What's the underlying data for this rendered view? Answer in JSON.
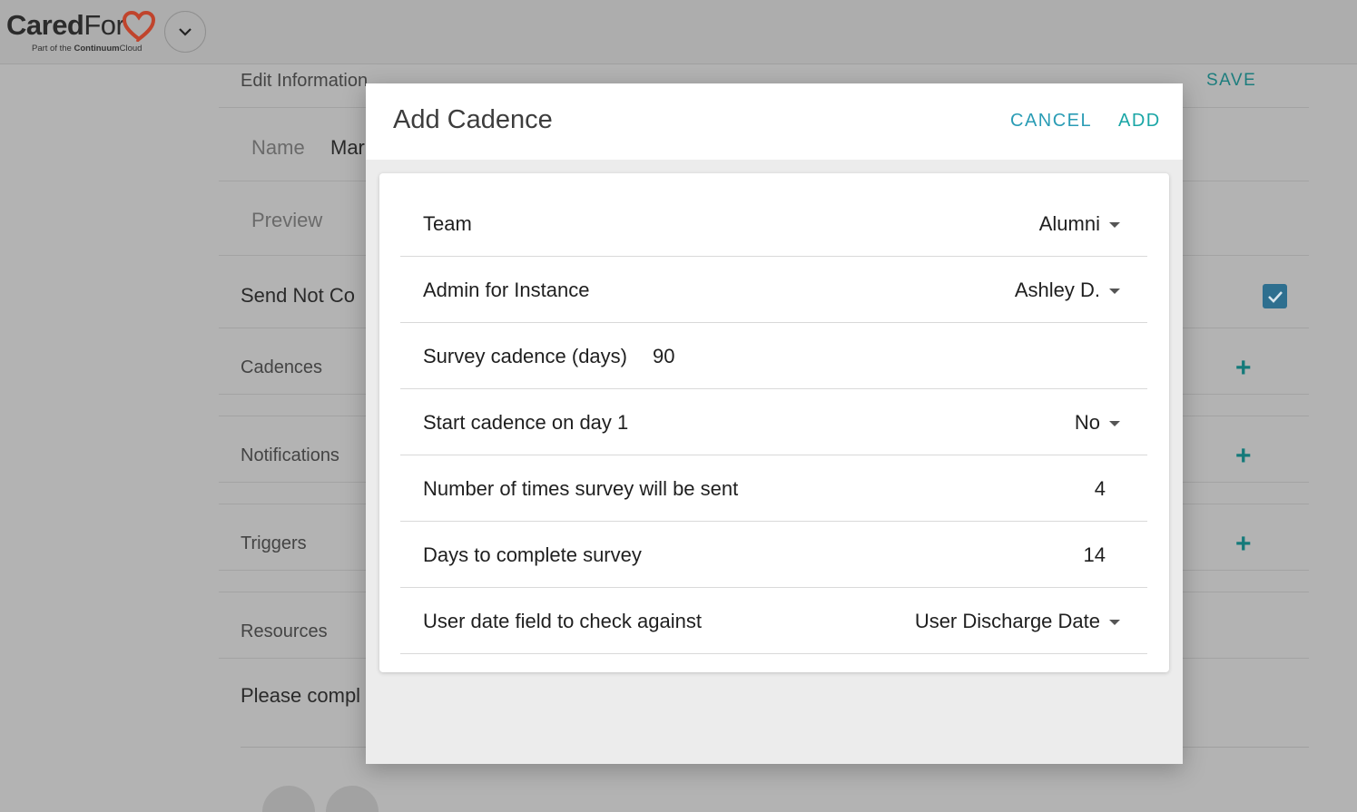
{
  "app": {
    "brand_main_bold": "Cared",
    "brand_main_light": "For",
    "brand_sub_prefix": "Part of the ",
    "brand_sub_bold": "Continuum",
    "brand_sub_suffix": "Cloud"
  },
  "background": {
    "edit_info_title": "Edit Information",
    "save_label": "SAVE",
    "name_label": "Name",
    "name_value_partial": "Mar",
    "preview_label": "Preview",
    "send_label_partial": "Send Not Co",
    "sections": [
      "Cadences",
      "Notifications",
      "Triggers",
      "Resources"
    ],
    "resources_text_partial": "Please compl"
  },
  "modal": {
    "title": "Add Cadence",
    "cancel_label": "CANCEL",
    "add_label": "ADD",
    "fields": {
      "team": {
        "label": "Team",
        "value": "Alumni"
      },
      "admin": {
        "label": "Admin for Instance",
        "value": "Ashley D."
      },
      "survey_cadence": {
        "label": "Survey cadence (days)",
        "value": "90"
      },
      "start_day1": {
        "label": "Start cadence on day 1",
        "value": "No"
      },
      "times_sent": {
        "label": "Number of times survey will be sent",
        "value": "4"
      },
      "days_complete": {
        "label": "Days to complete survey",
        "value": "14"
      },
      "date_field": {
        "label": "User date field to check against",
        "value": "User Discharge Date"
      }
    }
  },
  "colors": {
    "accent_teal": "#1aa6a6",
    "accent_blue": "#2a9cb5",
    "checkbox": "#2e6f8f",
    "overlay": "#b3b3b3"
  }
}
